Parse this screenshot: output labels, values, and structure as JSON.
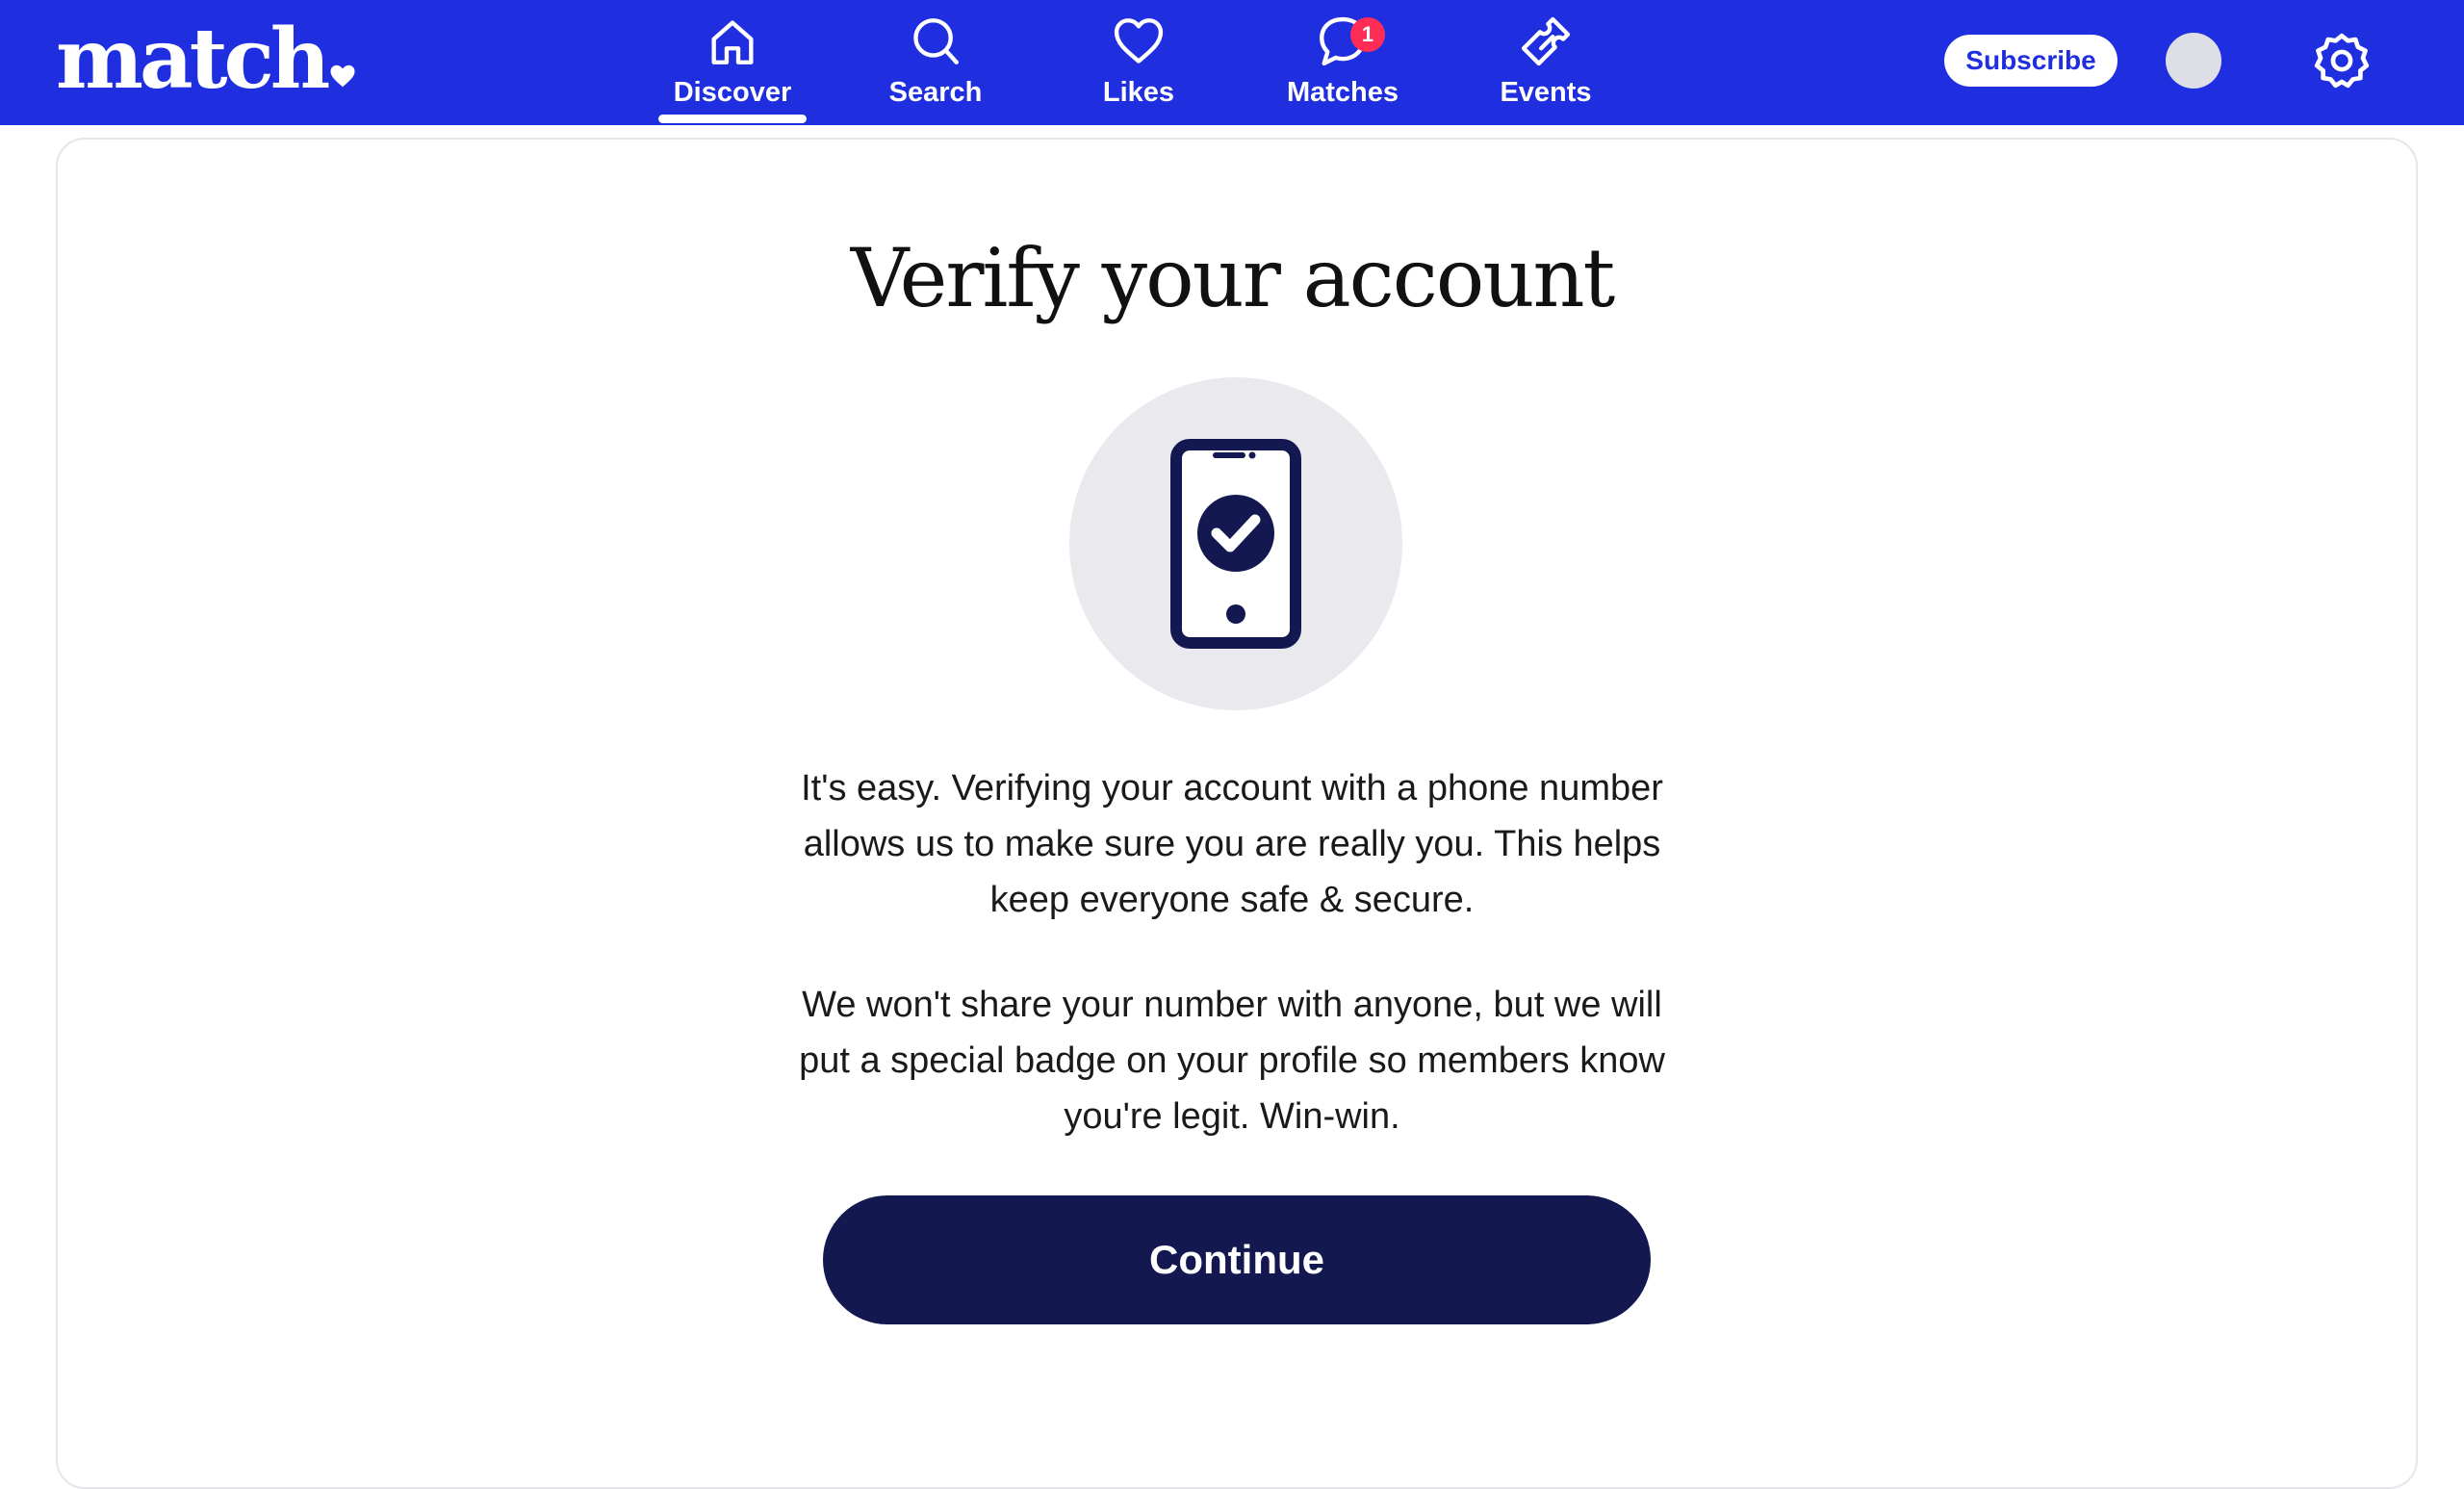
{
  "header": {
    "logo_text": "match",
    "nav": [
      {
        "label": "Discover",
        "icon": "home-icon",
        "active": true
      },
      {
        "label": "Search",
        "icon": "search-icon"
      },
      {
        "label": "Likes",
        "icon": "heart-icon"
      },
      {
        "label": "Matches",
        "icon": "chat-bubble-icon",
        "badge": "1"
      },
      {
        "label": "Events",
        "icon": "ticket-icon"
      }
    ],
    "subscribe_label": "Subscribe",
    "settings_icon": "gear-icon"
  },
  "main": {
    "title": "Verify your account",
    "illustration_icon": "phone-check-icon",
    "paragraph_1": "It's easy. Verifying your account with a phone number allows us to make sure you are really you. This helps keep everyone safe & secure.",
    "paragraph_2": "We won't share your number with anyone, but we will put a special badge on your profile so members know you're legit. Win-win.",
    "continue_label": "Continue"
  },
  "colors": {
    "brand_blue": "#1f2fe0",
    "navy": "#141850",
    "badge_red": "#ff2d55",
    "illus_bg": "#e9e9ee"
  }
}
